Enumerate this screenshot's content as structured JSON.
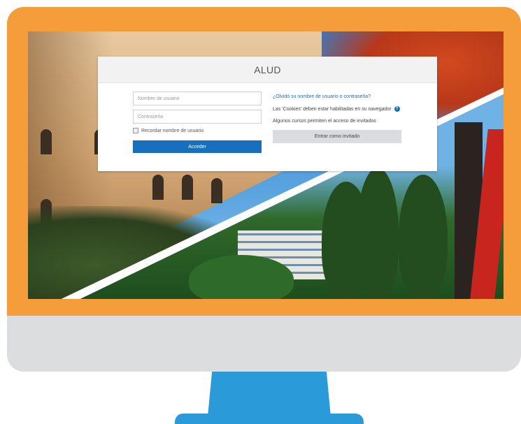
{
  "login": {
    "title": "ALUD",
    "username_placeholder": "Nombre de usuario",
    "password_placeholder": "Contraseña",
    "remember_label": "Recordar nombre de usuario",
    "submit_label": "Acceder",
    "forgot_link": "¿Olvidó su nombre de usuario o contraseña?",
    "cookies_text": "Las 'Cookies' deben estar habilitadas en su navegador",
    "guest_info": "Algunos cursos permiten el acceso de invitados",
    "guest_button": "Entrar como invitado"
  },
  "colors": {
    "bezel": "#f59d3a",
    "stand": "#2a9ad8",
    "primary": "#1670be"
  }
}
